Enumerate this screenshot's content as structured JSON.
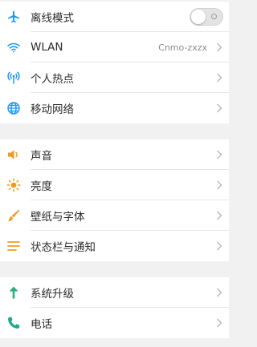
{
  "colors": {
    "blue": "#2196f3",
    "orange": "#f39a1e",
    "green": "#27b07a",
    "teal": "#1fa98f"
  },
  "groups": [
    {
      "items": [
        {
          "icon": "airplane-icon",
          "label": "离线模式",
          "control": "toggle",
          "toggle_on": false
        },
        {
          "icon": "wifi-icon",
          "label": "WLAN",
          "value": "Cnmo-zxzx",
          "control": "chevron"
        },
        {
          "icon": "hotspot-icon",
          "label": "个人热点",
          "control": "chevron"
        },
        {
          "icon": "globe-icon",
          "label": "移动网络",
          "control": "chevron"
        }
      ]
    },
    {
      "items": [
        {
          "icon": "speaker-icon",
          "label": "声音",
          "control": "chevron"
        },
        {
          "icon": "brightness-icon",
          "label": "亮度",
          "control": "chevron"
        },
        {
          "icon": "brush-icon",
          "label": "壁纸与字体",
          "control": "chevron"
        },
        {
          "icon": "menu-lines-icon",
          "label": "状态栏与通知",
          "control": "chevron"
        }
      ]
    },
    {
      "items": [
        {
          "icon": "upgrade-arrow-icon",
          "label": "系统升级",
          "control": "chevron"
        },
        {
          "icon": "phone-icon",
          "label": "电话",
          "control": "chevron"
        }
      ]
    }
  ]
}
